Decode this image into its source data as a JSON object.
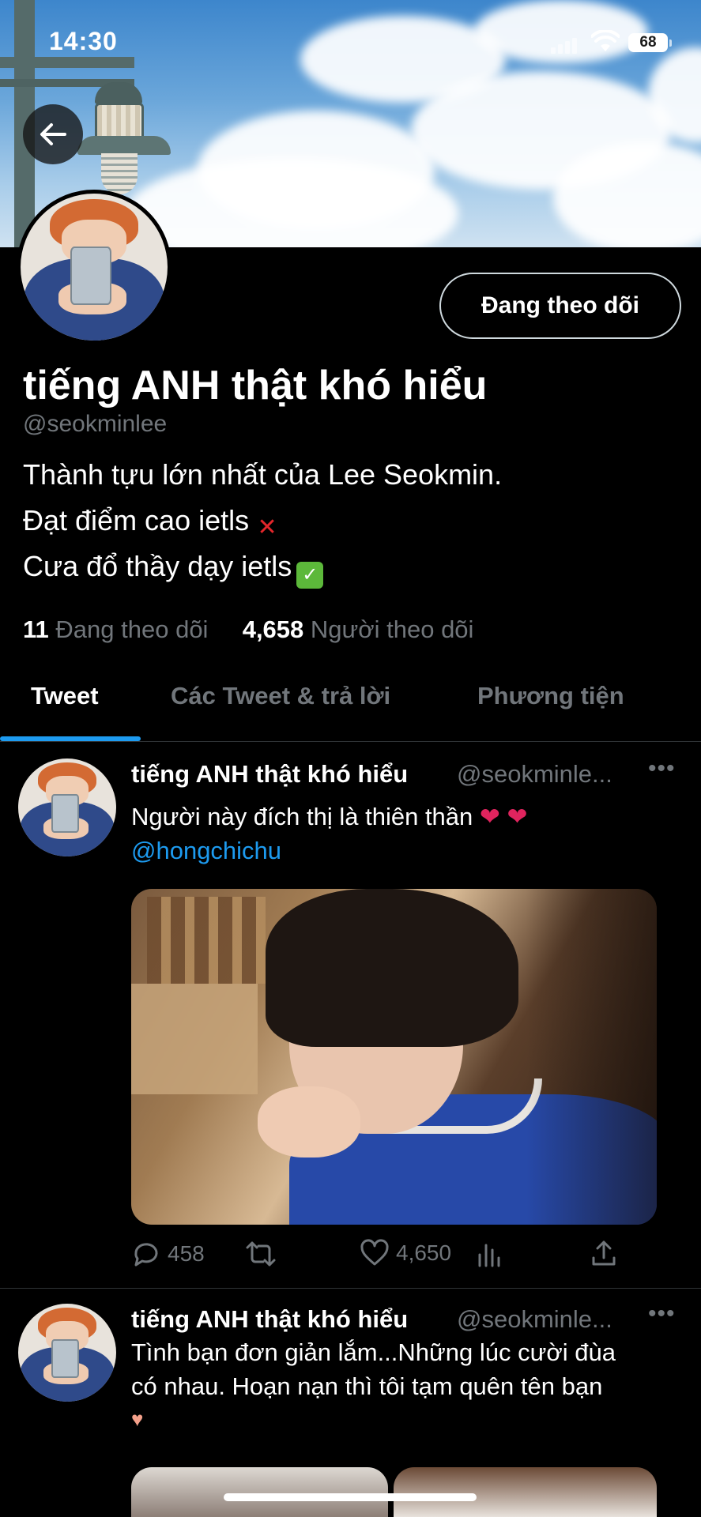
{
  "status_bar": {
    "time": "14:30",
    "battery": "68"
  },
  "profile": {
    "display_name": "tiếng ANH thật khó hiểu",
    "handle": "@seokminlee",
    "follow_button": "Đang theo dõi",
    "bio_lines": [
      "Thành tựu lớn nhất của Lee Seokmin.",
      "Đạt điểm cao ietls",
      "Cưa đổ thầy dạy ietls"
    ],
    "following_count": "11",
    "following_label": "Đang theo dõi",
    "followers_count": "4,658",
    "followers_label": "Người theo dõi"
  },
  "tabs": [
    {
      "label": "Tweet",
      "active": true
    },
    {
      "label": "Các Tweet & trả lời",
      "active": false
    },
    {
      "label": "Phương tiện",
      "active": false
    }
  ],
  "tweets": [
    {
      "name": "tiếng ANH thật khó hiểu",
      "handle": "@seokminle...",
      "text": "Người này đích thị là thiên thần",
      "mention": "@hongchichu",
      "replies": "458",
      "likes": "4,650"
    },
    {
      "name": "tiếng ANH thật khó hiểu",
      "handle": "@seokminle...",
      "text_line1": "Tình bạn đơn giản lắm...Những lúc cười đùa",
      "text_line2": "có nhau. Hoạn nạn thì tôi tạm quên tên bạn"
    }
  ],
  "colors": {
    "accent": "#1d9bf0",
    "muted": "#71767b",
    "background": "#000000",
    "like": "#e0245e"
  },
  "icons": [
    "back-arrow-icon",
    "wifi-icon",
    "signal-icon",
    "more-icon",
    "reply-icon",
    "retweet-icon",
    "like-icon",
    "views-icon",
    "share-icon"
  ]
}
